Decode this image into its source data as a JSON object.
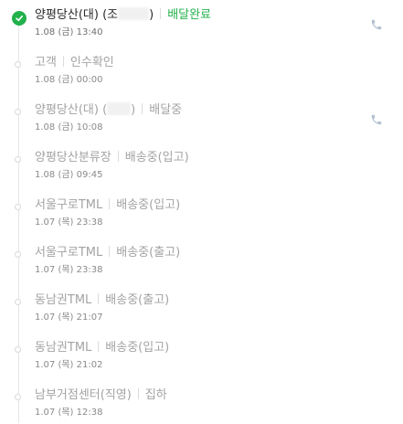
{
  "items": [
    {
      "place": "양평당산(대) (조",
      "suffix": ")",
      "status": "배달완료",
      "time": "1.08 (금) 13:40"
    },
    {
      "place": "고객",
      "status": "인수확인",
      "time": "1.08 (금) 00:00"
    },
    {
      "place": "양평당산(대) (",
      "suffix": ")",
      "status": "배달중",
      "time": "1.08 (금) 10:08"
    },
    {
      "place": "양평당산분류장",
      "status": "배송중(입고)",
      "time": "1.08 (금) 09:45"
    },
    {
      "place": "서울구로TML",
      "status": "배송중(입고)",
      "time": "1.07 (목) 23:38"
    },
    {
      "place": "서울구로TML",
      "status": "배송중(출고)",
      "time": "1.07 (목) 23:38"
    },
    {
      "place": "동남권TML",
      "status": "배송중(출고)",
      "time": "1.07 (목) 21:07"
    },
    {
      "place": "동남권TML",
      "status": "배송중(입고)",
      "time": "1.07 (목) 21:02"
    },
    {
      "place": "남부거점센터(직영)",
      "status": "집하",
      "time": "1.07 (목) 12:38"
    }
  ],
  "icons": {
    "check": "check-icon",
    "phone": "phone-icon"
  },
  "colors": {
    "accent": "#22b14c",
    "muted_text": "#a3a3a3",
    "timeline": "#e6e6e6"
  }
}
